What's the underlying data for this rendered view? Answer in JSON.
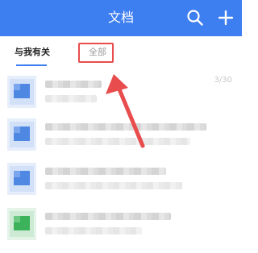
{
  "header": {
    "title": "文档",
    "search_icon": "search-icon",
    "add_icon": "plus-icon",
    "background": "#3d7ef0"
  },
  "tabs": [
    {
      "label": "与我有关",
      "active": true
    },
    {
      "label": "全部",
      "active": false,
      "highlighted": true
    }
  ],
  "list": {
    "counter": "3/30",
    "items": [
      {
        "icon": "doc-icon",
        "color": "#4f88e3"
      },
      {
        "icon": "doc-icon",
        "color": "#4f88e3"
      },
      {
        "icon": "doc-icon",
        "color": "#4f88e3"
      },
      {
        "icon": "sheet-icon",
        "color": "#3cb35a"
      }
    ]
  },
  "annotation": {
    "color": "#e84c4c",
    "target": "全部"
  }
}
